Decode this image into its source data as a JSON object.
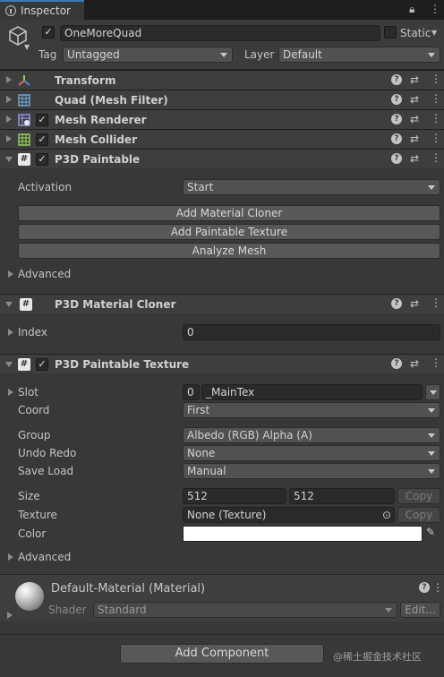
{
  "tab": {
    "title": "Inspector",
    "lock_glyph": "🔒",
    "menu_glyph": "⋮"
  },
  "object": {
    "name": "OneMoreQuad",
    "static_label": "Static",
    "tag_label": "Tag",
    "tag_value": "Untagged",
    "layer_label": "Layer",
    "layer_value": "Default"
  },
  "components": {
    "transform": "Transform",
    "mesh_filter": "Quad (Mesh Filter)",
    "mesh_renderer": "Mesh Renderer",
    "mesh_collider": "Mesh Collider",
    "p3d_paintable": "P3D Paintable",
    "p3d_material_cloner": "P3D Material Cloner",
    "p3d_paintable_texture": "P3D Paintable Texture"
  },
  "paintable": {
    "activation_label": "Activation",
    "activation_value": "Start",
    "buttons": [
      "Add Material Cloner",
      "Add Paintable Texture",
      "Analyze Mesh"
    ],
    "advanced_label": "Advanced"
  },
  "cloner": {
    "index_label": "Index",
    "index_value": "0"
  },
  "texture": {
    "slot_label": "Slot",
    "slot_index": "0",
    "slot_name": "_MainTex",
    "coord_label": "Coord",
    "coord_value": "First",
    "group_label": "Group",
    "group_value": "Albedo (RGB) Alpha (A)",
    "undo_label": "Undo Redo",
    "undo_value": "None",
    "save_label": "Save Load",
    "save_value": "Manual",
    "size_label": "Size",
    "size_w": "512",
    "size_h": "512",
    "copy_label": "Copy",
    "texture_label": "Texture",
    "texture_value": "None (Texture)",
    "color_label": "Color",
    "color_value": "#ffffff",
    "advanced_label": "Advanced"
  },
  "material": {
    "name": "Default-Material (Material)",
    "shader_label": "Shader",
    "shader_value": "Standard",
    "edit_label": "Edit..."
  },
  "footer": {
    "add_component": "Add Component",
    "watermark": "@稀土掘金技术社区"
  },
  "icons": {
    "help": "?",
    "presets": "⇄",
    "more": "⋮",
    "check": "✓",
    "picker": "⊙",
    "eyedropper": "✎"
  },
  "colors": {
    "tab_accent": "#3a79bb",
    "background": "#383838",
    "header": "#3e3e3e"
  }
}
